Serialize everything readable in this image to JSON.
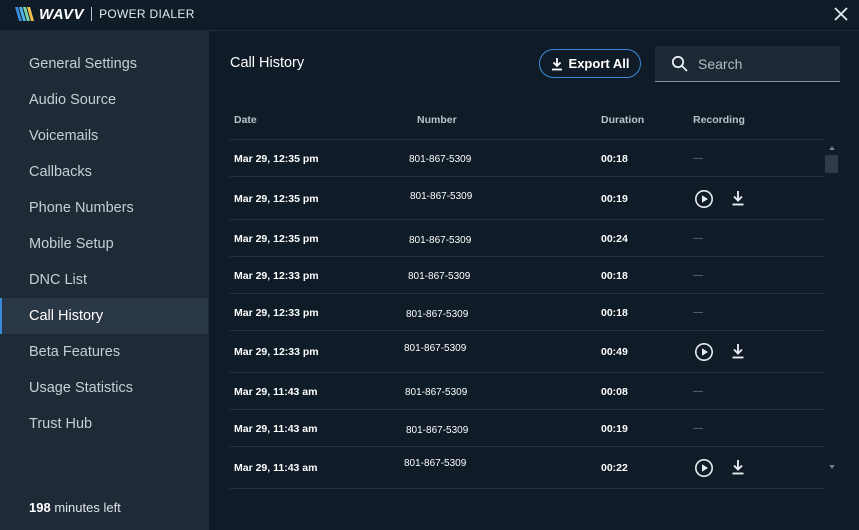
{
  "app": {
    "logo_text": "WAVV",
    "product_name": "POWER DIALER",
    "close_icon": "close-icon"
  },
  "sidebar": {
    "items": [
      {
        "label": "General Settings"
      },
      {
        "label": "Audio Source"
      },
      {
        "label": "Voicemails"
      },
      {
        "label": "Callbacks"
      },
      {
        "label": "Phone Numbers"
      },
      {
        "label": "Mobile Setup"
      },
      {
        "label": "DNC List"
      },
      {
        "label": "Call History",
        "active": true
      },
      {
        "label": "Beta Features"
      },
      {
        "label": "Usage Statistics"
      },
      {
        "label": "Trust Hub"
      }
    ],
    "minutes_value": "198",
    "minutes_suffix": " minutes left"
  },
  "main": {
    "title": "Call History",
    "export_label": "Export All",
    "export_icon": "download-icon",
    "search_placeholder": "Search",
    "search_value": "",
    "search_icon": "search-icon"
  },
  "table": {
    "headers": {
      "date": "Date",
      "number": "Number",
      "duration": "Duration",
      "recording": "Recording"
    },
    "no_recording_text": "—",
    "rows": [
      {
        "date": "Mar 29, 12:35 pm",
        "number": "801-867-5309",
        "duration": "00:18",
        "recording": false
      },
      {
        "date": "Mar 29, 12:35 pm",
        "number": "801-867-5309",
        "duration": "00:19",
        "recording": true
      },
      {
        "date": "Mar 29, 12:35 pm",
        "number": "801-867-5309",
        "duration": "00:24",
        "recording": false
      },
      {
        "date": "Mar 29, 12:33 pm",
        "number": "801-867-5309",
        "duration": "00:18",
        "recording": false
      },
      {
        "date": "Mar 29, 12:33 pm",
        "number": "801-867-5309",
        "duration": "00:18",
        "recording": false
      },
      {
        "date": "Mar 29, 12:33 pm",
        "number": "801-867-5309",
        "duration": "00:49",
        "recording": true
      },
      {
        "date": "Mar 29, 11:43 am",
        "number": "801-867-5309",
        "duration": "00:08",
        "recording": false
      },
      {
        "date": "Mar 29, 11:43 am",
        "number": "801-867-5309",
        "duration": "00:19",
        "recording": false
      },
      {
        "date": "Mar 29, 11:43 am",
        "number": "801-867-5309",
        "duration": "00:22",
        "recording": true
      }
    ]
  },
  "colors": {
    "background": "#0f1b26",
    "sidebar": "#1e2a36",
    "sidebar_active": "#2a3744",
    "accent": "#3b8bdb"
  }
}
